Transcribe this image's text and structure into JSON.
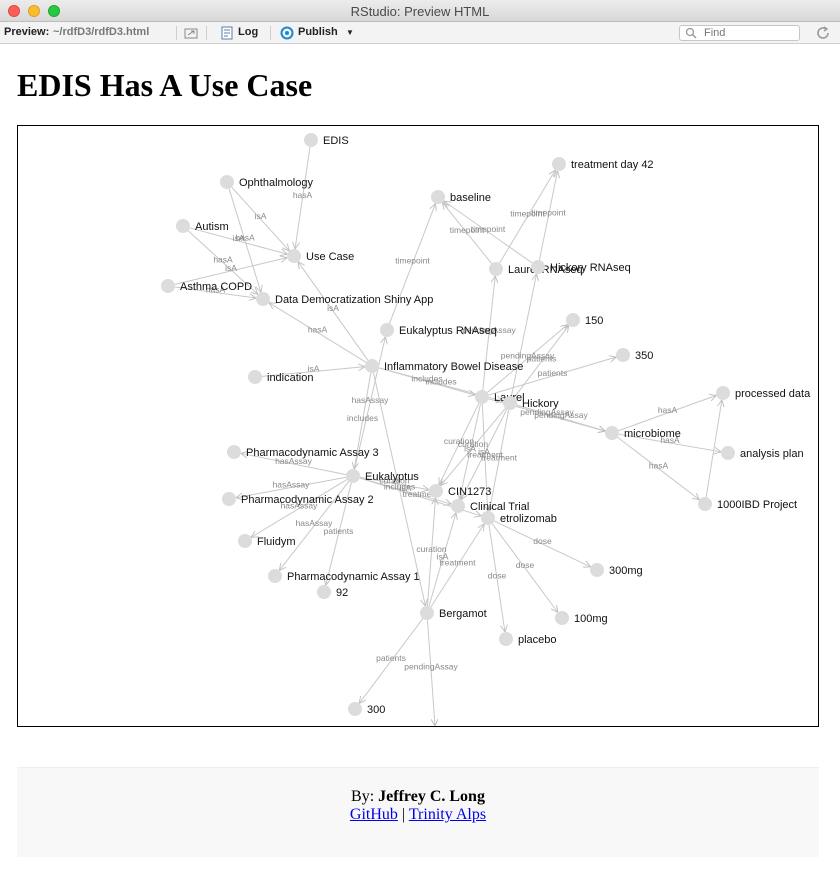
{
  "window": {
    "title": "RStudio: Preview HTML"
  },
  "toolbar": {
    "preview_label": "Preview:",
    "path": "~/rdfD3/rdfD3.html",
    "log_label": "Log",
    "publish_label": "Publish",
    "find_placeholder": "Find"
  },
  "page": {
    "title": "EDIS Has A Use Case"
  },
  "footer": {
    "by_prefix": "By:",
    "author": "Jeffrey C. Long",
    "link1": "GitHub",
    "separator": "|",
    "link2": "Trinity Alps"
  },
  "graph": {
    "node_color": "#dcdcdc",
    "edge_color": "#c8c8c8",
    "nodes": [
      {
        "id": "EDIS",
        "label": "EDIS"
      },
      {
        "id": "Ophthalmology",
        "label": "Ophthalmology"
      },
      {
        "id": "Autism",
        "label": "Autism"
      },
      {
        "id": "UseCase",
        "label": "Use Case"
      },
      {
        "id": "AsthmaCOPD",
        "label": "Asthma COPD"
      },
      {
        "id": "DDShiny",
        "label": "Data Democratization Shiny App"
      },
      {
        "id": "baseline",
        "label": "baseline"
      },
      {
        "id": "day42",
        "label": "treatment day 42"
      },
      {
        "id": "LaurelRNA",
        "label": "Laurel RNAseq"
      },
      {
        "id": "HickoryRNA",
        "label": "Hickory RNAseq"
      },
      {
        "id": "EukRNA",
        "label": "Eukalyptus RNAseq"
      },
      {
        "id": "n150",
        "label": "150"
      },
      {
        "id": "n350",
        "label": "350"
      },
      {
        "id": "IBD",
        "label": "Inflammatory Bowel Disease"
      },
      {
        "id": "indication",
        "label": "indication"
      },
      {
        "id": "Laurel",
        "label": "Laurel"
      },
      {
        "id": "Hickory",
        "label": "Hickory"
      },
      {
        "id": "processed",
        "label": "processed data"
      },
      {
        "id": "microbiome",
        "label": "microbiome"
      },
      {
        "id": "analysis",
        "label": "analysis plan"
      },
      {
        "id": "PDA3",
        "label": "Pharmacodynamic Assay 3"
      },
      {
        "id": "Eukalyptus",
        "label": "Eukalyptus"
      },
      {
        "id": "CIN1273",
        "label": "CIN1273"
      },
      {
        "id": "PDA2",
        "label": "Pharmacodynamic Assay 2"
      },
      {
        "id": "ClinicalTrial",
        "label": "Clinical Trial"
      },
      {
        "id": "etrolizomab",
        "label": "etrolizomab"
      },
      {
        "id": "n1000IBD",
        "label": "1000IBD Project"
      },
      {
        "id": "Fluidym",
        "label": "Fluidym"
      },
      {
        "id": "n300mg",
        "label": "300mg"
      },
      {
        "id": "PDA1",
        "label": "Pharmacodynamic Assay 1"
      },
      {
        "id": "n92",
        "label": "92"
      },
      {
        "id": "n100mg",
        "label": "100mg"
      },
      {
        "id": "Bergamot",
        "label": "Bergamot"
      },
      {
        "id": "placebo",
        "label": "placebo"
      },
      {
        "id": "n300",
        "label": "300"
      }
    ],
    "edges": [
      {
        "s": "EDIS",
        "t": "UseCase",
        "label": "hasA"
      },
      {
        "s": "Ophthalmology",
        "t": "UseCase",
        "label": "isA"
      },
      {
        "s": "Ophthalmology",
        "t": "DDShiny",
        "label": "hasA"
      },
      {
        "s": "Autism",
        "t": "UseCase",
        "label": "isA"
      },
      {
        "s": "Autism",
        "t": "DDShiny",
        "label": "hasA"
      },
      {
        "s": "AsthmaCOPD",
        "t": "UseCase",
        "label": "isA"
      },
      {
        "s": "AsthmaCOPD",
        "t": "DDShiny",
        "label": "hasA"
      },
      {
        "s": "IBD",
        "t": "UseCase",
        "label": "isA"
      },
      {
        "s": "IBD",
        "t": "DDShiny",
        "label": "hasA"
      },
      {
        "s": "indication",
        "t": "IBD",
        "label": "isA"
      },
      {
        "s": "IBD",
        "t": "Laurel",
        "label": "includes"
      },
      {
        "s": "IBD",
        "t": "Hickory",
        "label": "includes"
      },
      {
        "s": "IBD",
        "t": "Eukalyptus",
        "label": "includes"
      },
      {
        "s": "IBD",
        "t": "Bergamot",
        "label": "includes"
      },
      {
        "s": "Eukalyptus",
        "t": "EukRNA",
        "label": "hasAssay"
      },
      {
        "s": "EukRNA",
        "t": "baseline",
        "label": "timepoint"
      },
      {
        "s": "LaurelRNA",
        "t": "baseline",
        "label": "timepoint"
      },
      {
        "s": "LaurelRNA",
        "t": "day42",
        "label": "timepoint"
      },
      {
        "s": "HickoryRNA",
        "t": "baseline",
        "label": "timepoint"
      },
      {
        "s": "HickoryRNA",
        "t": "day42",
        "label": "timepoint"
      },
      {
        "s": "Laurel",
        "t": "LaurelRNA",
        "label": "pendingAssay"
      },
      {
        "s": "Laurel",
        "t": "n150",
        "label": "pendingAssay"
      },
      {
        "s": "Laurel",
        "t": "n350",
        "label": "patients"
      },
      {
        "s": "Hickory",
        "t": "n150",
        "label": "patients"
      },
      {
        "s": "Hickory",
        "t": "HickoryRNA",
        "label": ""
      },
      {
        "s": "Hickory",
        "t": "microbiome",
        "label": "pendingAssay"
      },
      {
        "s": "Laurel",
        "t": "microbiome",
        "label": "pendingAssay"
      },
      {
        "s": "microbiome",
        "t": "processed",
        "label": "hasA"
      },
      {
        "s": "microbiome",
        "t": "analysis",
        "label": "hasA"
      },
      {
        "s": "microbiome",
        "t": "n1000IBD",
        "label": "hasA"
      },
      {
        "s": "n1000IBD",
        "t": "processed",
        "label": ""
      },
      {
        "s": "Laurel",
        "t": "CIN1273",
        "label": "curation"
      },
      {
        "s": "Laurel",
        "t": "ClinicalTrial",
        "label": "isA"
      },
      {
        "s": "Laurel",
        "t": "etrolizomab",
        "label": "treatment"
      },
      {
        "s": "Hickory",
        "t": "CIN1273",
        "label": "curation"
      },
      {
        "s": "Hickory",
        "t": "ClinicalTrial",
        "label": "isA"
      },
      {
        "s": "Hickory",
        "t": "etrolizomab",
        "label": "treatment"
      },
      {
        "s": "Eukalyptus",
        "t": "CIN1273",
        "label": "curation"
      },
      {
        "s": "Eukalyptus",
        "t": "ClinicalTrial",
        "label": "isA"
      },
      {
        "s": "Eukalyptus",
        "t": "etrolizomab",
        "label": "treatment"
      },
      {
        "s": "Eukalyptus",
        "t": "PDA3",
        "label": "hasAssay"
      },
      {
        "s": "Eukalyptus",
        "t": "PDA2",
        "label": "hasAssay"
      },
      {
        "s": "Eukalyptus",
        "t": "Fluidym",
        "label": "hasAssay"
      },
      {
        "s": "Eukalyptus",
        "t": "PDA1",
        "label": "hasAssay"
      },
      {
        "s": "Eukalyptus",
        "t": "n92",
        "label": "patients"
      },
      {
        "s": "etrolizomab",
        "t": "n300mg",
        "label": "dose"
      },
      {
        "s": "etrolizomab",
        "t": "n100mg",
        "label": "dose"
      },
      {
        "s": "etrolizomab",
        "t": "placebo",
        "label": "dose"
      },
      {
        "s": "Bergamot",
        "t": "CIN1273",
        "label": "curation"
      },
      {
        "s": "Bergamot",
        "t": "ClinicalTrial",
        "label": "isA"
      },
      {
        "s": "Bergamot",
        "t": "etrolizomab",
        "label": "treatment"
      },
      {
        "s": "Bergamot",
        "t": "n300",
        "label": "patients"
      },
      {
        "s": "Bergamot",
        "t": "bottom_out",
        "label": "pendingAssay"
      }
    ]
  }
}
